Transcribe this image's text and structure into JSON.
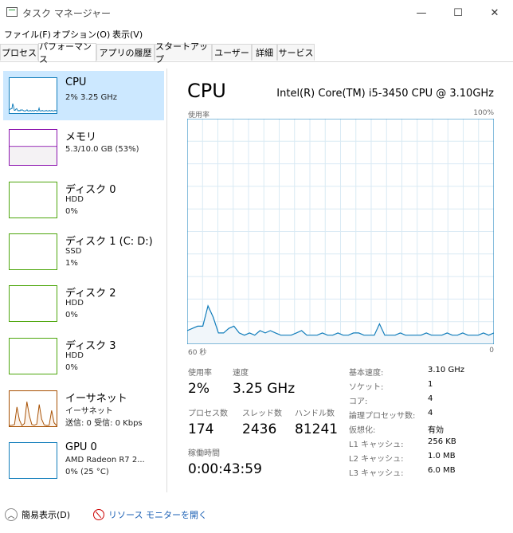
{
  "window": {
    "title": "タスク マネージャー",
    "min": "—",
    "max": "☐",
    "close": "✕"
  },
  "menu": [
    "ファイル(F)",
    "オプション(O)",
    "表示(V)"
  ],
  "tabs": [
    "プロセス",
    "パフォーマンス",
    "アプリの履歴",
    "スタートアップ",
    "ユーザー",
    "詳細",
    "サービス"
  ],
  "sidebar": [
    {
      "title": "CPU",
      "lines": [
        "2% 3.25 GHz"
      ],
      "color": "#117dbb",
      "fill": "#f1f6fa"
    },
    {
      "title": "メモリ",
      "lines": [
        "5.3/10.0 GB (53%)"
      ],
      "color": "#8b12ae",
      "fill": "#f4f2f4",
      "level": 0.53
    },
    {
      "title": "ディスク 0",
      "lines": [
        "HDD",
        "0%"
      ],
      "color": "#4da60c",
      "fill": "#ffffff"
    },
    {
      "title": "ディスク 1 (C: D:)",
      "lines": [
        "SSD",
        "1%"
      ],
      "color": "#4da60c",
      "fill": "#ffffff"
    },
    {
      "title": "ディスク 2",
      "lines": [
        "HDD",
        "0%"
      ],
      "color": "#4da60c",
      "fill": "#ffffff"
    },
    {
      "title": "ディスク 3",
      "lines": [
        "HDD",
        "0%"
      ],
      "color": "#4da60c",
      "fill": "#ffffff"
    },
    {
      "title": "イーサネット",
      "lines": [
        "イーサネット",
        "送信: 0 受信: 0 Kbps"
      ],
      "color": "#a74f01",
      "fill": "#ffffff"
    },
    {
      "title": "GPU 0",
      "lines": [
        "AMD Radeon R7 2...",
        "0% (25 °C)"
      ],
      "color": "#117dbb",
      "fill": "#ffffff"
    }
  ],
  "main": {
    "title": "CPU",
    "model": "Intel(R) Core(TM) i5-3450 CPU @ 3.10GHz",
    "graph_label": "使用率",
    "graph_max": "100%",
    "graph_time": "60 秒",
    "graph_min": "0",
    "stats": {
      "usage_label": "使用率",
      "usage": "2%",
      "speed_label": "速度",
      "speed": "3.25 GHz",
      "processes_label": "プロセス数",
      "processes": "174",
      "threads_label": "スレッド数",
      "threads": "2436",
      "handles_label": "ハンドル数",
      "handles": "81241",
      "uptime_label": "稼働時間",
      "uptime": "0:00:43:59"
    },
    "specs": [
      {
        "k": "基本速度:",
        "v": "3.10 GHz"
      },
      {
        "k": "ソケット:",
        "v": "1"
      },
      {
        "k": "コア:",
        "v": "4"
      },
      {
        "k": "論理プロセッサ数:",
        "v": "4"
      },
      {
        "k": "仮想化:",
        "v": "有効"
      },
      {
        "k": "L1 キャッシュ:",
        "v": "256 KB"
      },
      {
        "k": "L2 キャッシュ:",
        "v": "1.0 MB"
      },
      {
        "k": "L3 キャッシュ:",
        "v": "6.0 MB"
      }
    ]
  },
  "cpu_history": [
    6,
    7,
    8,
    8,
    17,
    12,
    5,
    5,
    7,
    8,
    5,
    4,
    5,
    4,
    6,
    5,
    6,
    5,
    4,
    4,
    4,
    5,
    6,
    4,
    4,
    4,
    5,
    4,
    4,
    5,
    4,
    4,
    5,
    5,
    4,
    4,
    4,
    9,
    4,
    4,
    4,
    5,
    4,
    4,
    4,
    4,
    5,
    4,
    4,
    4,
    5,
    4,
    4,
    5,
    4,
    4,
    4,
    5,
    4,
    5
  ],
  "ethernet_history": [
    2,
    3,
    5,
    55,
    18,
    2,
    8,
    70,
    30,
    5,
    3,
    6,
    62,
    20,
    4,
    2,
    3,
    45,
    10,
    2
  ],
  "bottom": {
    "fewer": "簡易表示(D)",
    "resmon": "リソース モニターを開く"
  },
  "colors": {
    "cpu": "#117dbb",
    "cpu_fill": "#f1f6fa",
    "grid": "#d9eaf4",
    "selected": "#cce8ff"
  }
}
